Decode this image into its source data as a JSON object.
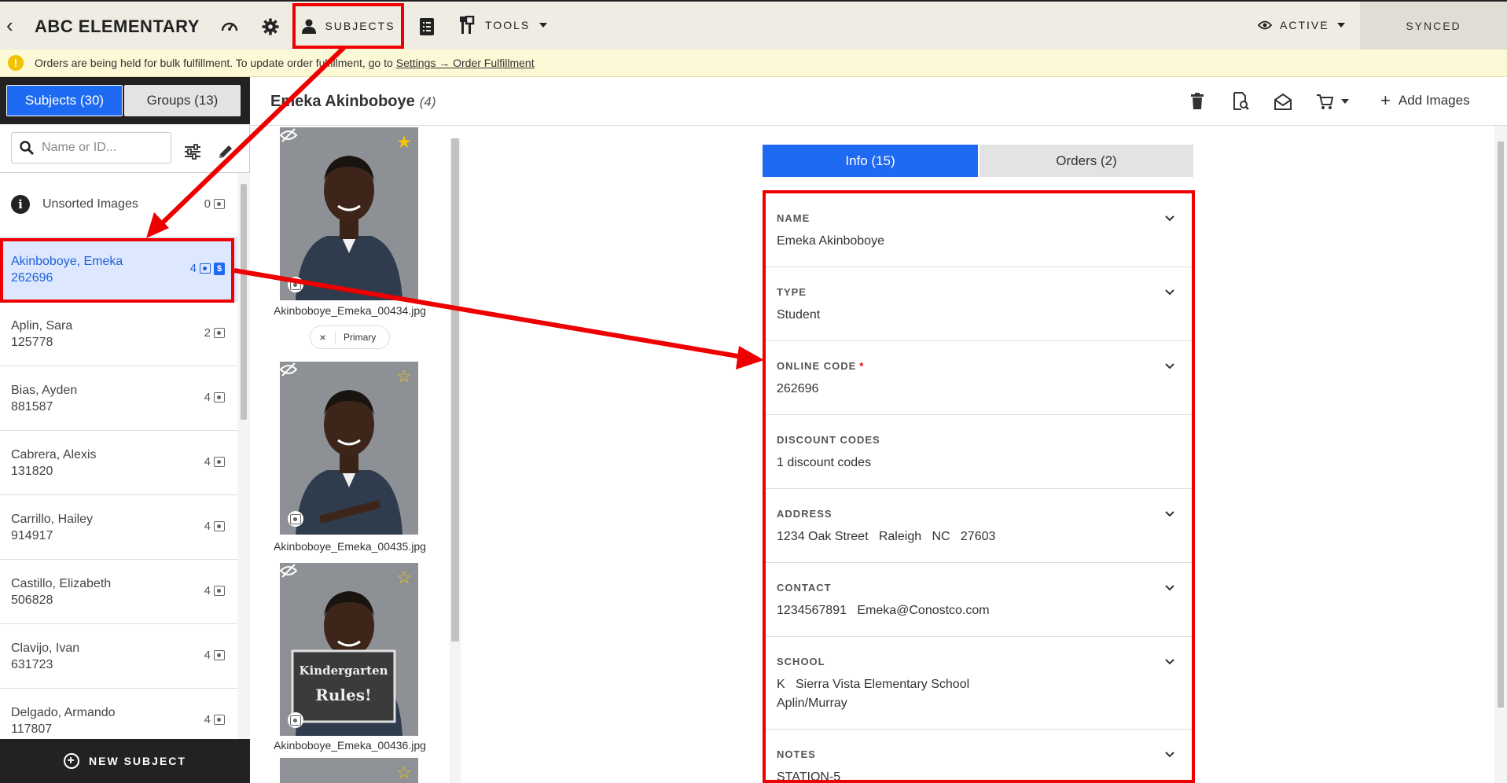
{
  "topbar": {
    "title": "ABC ELEMENTARY",
    "subjects_label": "SUBJECTS",
    "tools_label": "TOOLS",
    "active_label": "ACTIVE",
    "synced_label": "SYNCED",
    "icons": [
      "back-icon",
      "dashboard-icon",
      "gear-icon",
      "person-icon",
      "list-icon",
      "tools-icon",
      "eye-icon",
      "chevron-down-icon"
    ]
  },
  "notice": {
    "text": "Orders are being held for bulk fulfillment. To update order fulfillment, go to",
    "link": "Settings → Order Fulfillment"
  },
  "sidebar": {
    "tabs": [
      {
        "label": "Subjects (30)"
      },
      {
        "label": "Groups (13)"
      }
    ],
    "search_placeholder": "Name or ID...",
    "unsorted": {
      "label": "Unsorted Images",
      "count": "0"
    },
    "items": [
      {
        "name": "Akinboboye, Emeka",
        "id": "262696",
        "count": "4",
        "selected": true
      },
      {
        "name": "Aplin, Sara",
        "id": "125778",
        "count": "2"
      },
      {
        "name": "Bias, Ayden",
        "id": "881587",
        "count": "4"
      },
      {
        "name": "Cabrera, Alexis",
        "id": "131820",
        "count": "4"
      },
      {
        "name": "Carrillo, Hailey",
        "id": "914917",
        "count": "4"
      },
      {
        "name": "Castillo, Elizabeth",
        "id": "506828",
        "count": "4"
      },
      {
        "name": "Clavijo, Ivan",
        "id": "631723",
        "count": "4"
      },
      {
        "name": "Delgado, Armando",
        "id": "117807",
        "count": "4"
      }
    ],
    "new_subject_label": "NEW SUBJECT"
  },
  "main": {
    "title": "Emeka Akinboboye",
    "count": "(4)",
    "add_images_label": "Add Images",
    "images": [
      {
        "filename": "Akinboboye_Emeka_00434.jpg",
        "starred": true
      },
      {
        "filename": "Akinboboye_Emeka_00435.jpg",
        "starred": false
      },
      {
        "filename": "Akinboboye_Emeka_00436.jpg",
        "starred": false
      }
    ],
    "primary_label": "Primary",
    "primary_remove": "×",
    "sign_text_1": "Kindergarten",
    "sign_text_2": "Rules!"
  },
  "info": {
    "tabs": [
      {
        "label": "Info (15)"
      },
      {
        "label": "Orders (2)"
      }
    ],
    "fields": [
      {
        "label": "NAME",
        "value": "Emeka Akinboboye"
      },
      {
        "label": "TYPE",
        "value": "Student"
      },
      {
        "label": "ONLINE CODE",
        "value": "262696",
        "required": "*"
      },
      {
        "label": "DISCOUNT CODES",
        "value": "1 discount codes"
      },
      {
        "label": "ADDRESS",
        "value": "1234 Oak Street   Raleigh   NC   27603"
      },
      {
        "label": "CONTACT",
        "value": "1234567891   Emeka@Conostco.com"
      },
      {
        "label": "SCHOOL",
        "value": "K   Sierra Vista Elementary School",
        "value2": "Aplin/Murray"
      },
      {
        "label": "NOTES",
        "value": "STATION-5"
      }
    ]
  },
  "colors": {
    "accent": "#1f6af2",
    "annotation": "#e00000",
    "topbar": "#efece4",
    "notice": "#fdf8d6",
    "star": "#f4c20d"
  }
}
